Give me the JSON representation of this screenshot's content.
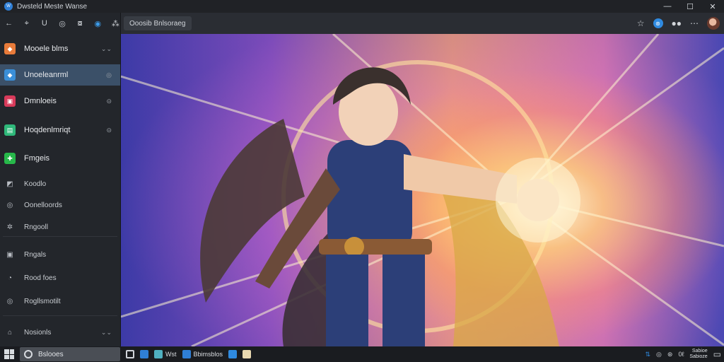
{
  "window": {
    "title": "Dwsteld Meste Wanse",
    "app_icon_label": "W",
    "controls": [
      "—",
      "☐",
      "✕"
    ]
  },
  "sidebar": {
    "toolbar": [
      "←",
      "⌖",
      "U",
      "◎",
      "⧇",
      "◉",
      "⁂"
    ],
    "items": [
      {
        "label": "Mooele blms",
        "color": "#e87b3a",
        "glyph": "◆",
        "trail": "⌄⌄",
        "selected": false
      },
      {
        "label": "Unoeleanrml",
        "color": "#3a8fd8",
        "glyph": "◆",
        "trail": "◎",
        "selected": true
      },
      {
        "label": "Dmnloeis",
        "color": "#d83a5a",
        "glyph": "▣",
        "trail": "⊝",
        "selected": false
      },
      {
        "label": "Hoqdenlmriqt",
        "color": "#2fb87a",
        "glyph": "▤",
        "trail": "⊝",
        "selected": false
      },
      {
        "label": "Fmgeis",
        "color": "#27b84a",
        "glyph": "✚",
        "trail": "",
        "selected": false
      }
    ],
    "small_items": [
      {
        "label": "Koodlo",
        "glyph": "◩"
      },
      {
        "label": "Oonelloords",
        "glyph": "◎"
      },
      {
        "label": "Rngooll",
        "glyph": "✲"
      },
      {
        "label": "Rngals",
        "glyph": "▣"
      },
      {
        "label": "Rood foes",
        "glyph": "◔"
      },
      {
        "label": "Rogllsmotilt",
        "glyph": "◎"
      }
    ],
    "bottom_item": {
      "label": "Nosionls",
      "glyph": "⌂",
      "trail": "⌄⌄"
    }
  },
  "addressbar": {
    "text": "Ooosib Bnlsoraeg",
    "right_icons": [
      "☆",
      "⊛",
      "●●",
      "⋯"
    ]
  },
  "taskbar": {
    "search_text": "Bslooes",
    "apps": [
      {
        "label": "",
        "color": "#d0d4d9"
      },
      {
        "label": "",
        "color": "#2f7fd6"
      },
      {
        "label": "Wst",
        "color": "#4fb0c0"
      },
      {
        "label": "Bbimsblos",
        "color": "#2f7fd6"
      },
      {
        "label": "",
        "color": "#2f8ae0"
      },
      {
        "label": "",
        "color": "#e8d8b0"
      }
    ],
    "tray_icons": [
      "⇅",
      "◎",
      "⊛",
      "0ℓ"
    ],
    "clock_time": "Sabioe",
    "clock_date": "Sabioze"
  },
  "hero": {
    "alt_subject": "anime-hero-artwork"
  }
}
